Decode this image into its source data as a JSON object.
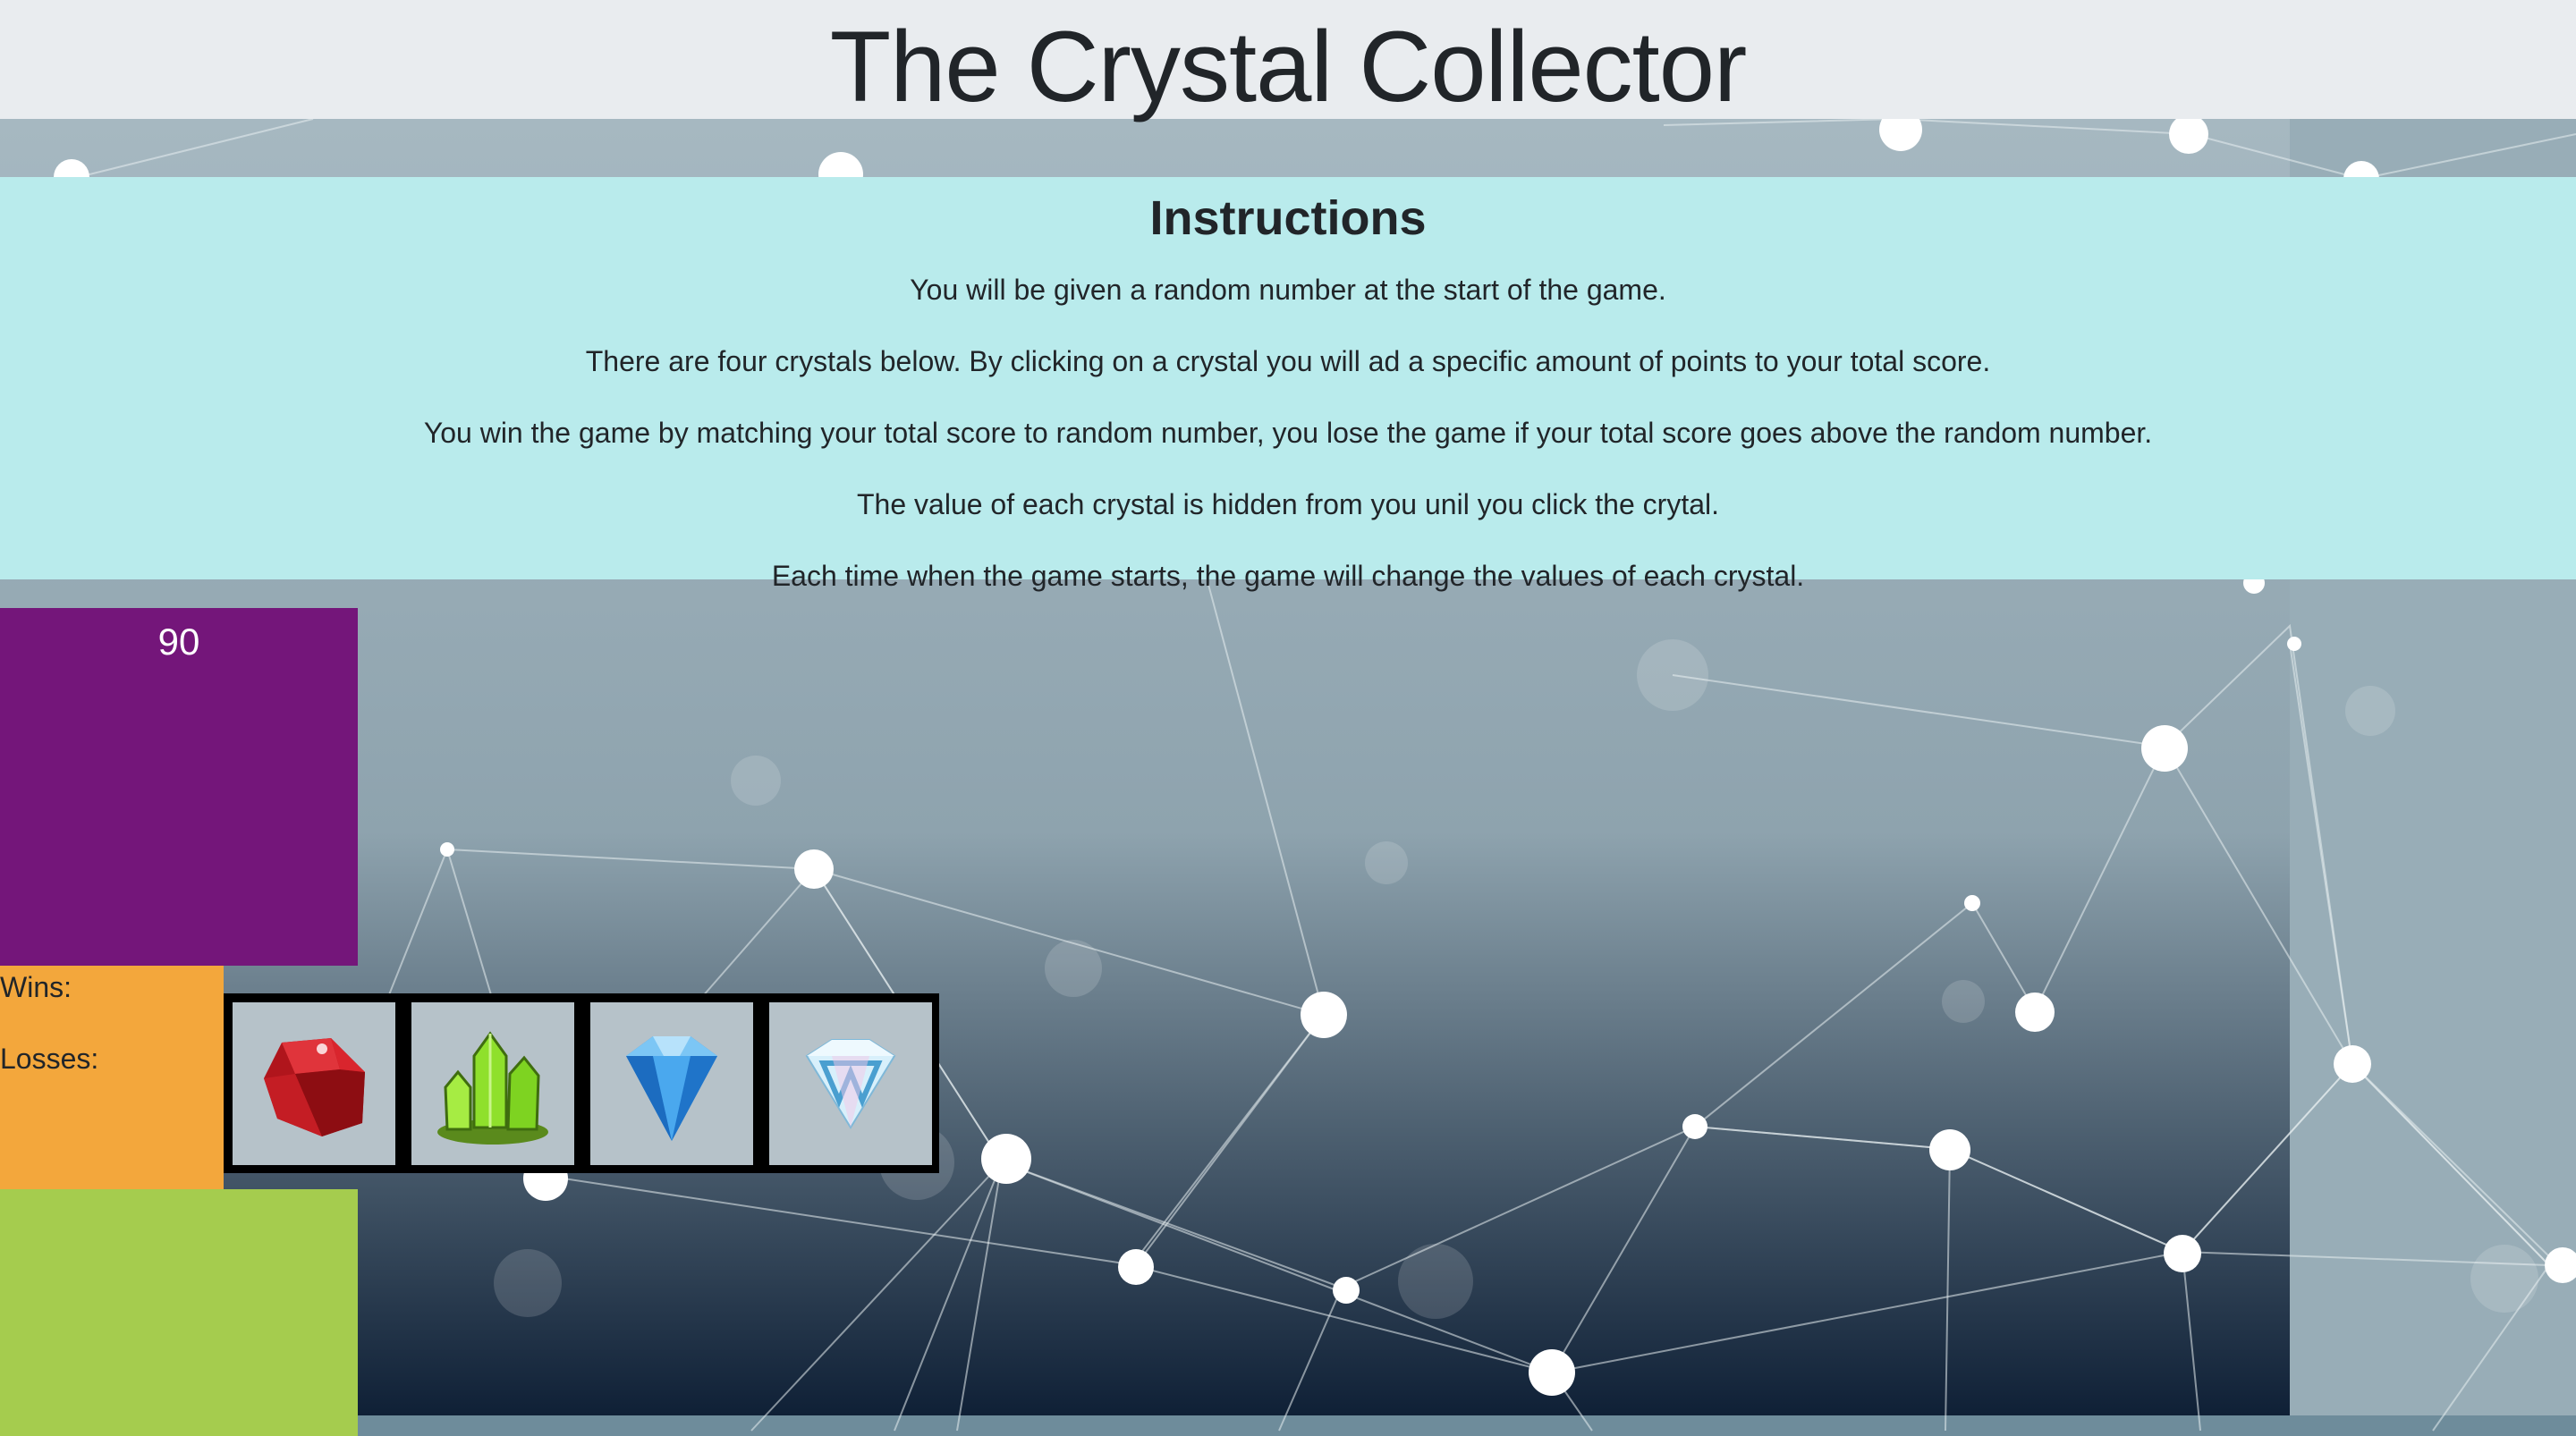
{
  "header": {
    "title": "The Crystal Collector"
  },
  "instructions": {
    "heading": "Instructions",
    "lines": [
      "You will be given a random number at the start of the game.",
      "There are four crystals below. By clicking on a crystal you will ad a specific amount of points to your total score.",
      "You win the game by matching your total score to random number, you lose the game if your total score goes above the random number.",
      "The value of each crystal is hidden from you unil you click the crytal.",
      "Each time when the game starts, the game will change the values of each crystal."
    ]
  },
  "game": {
    "target_number": "90",
    "wins_label": "Wins:",
    "losses_label": "Losses:",
    "crystals": [
      {
        "icon": "red-ruby-icon",
        "color": "#c0151c"
      },
      {
        "icon": "green-crystal-icon",
        "color": "#7ed321"
      },
      {
        "icon": "blue-diamond-icon",
        "color": "#2f8fe0"
      },
      {
        "icon": "white-diamond-icon",
        "color": "#bfe6f7"
      }
    ]
  },
  "colors": {
    "header_bg": "#e9ecef",
    "instructions_bg": "#b9ebec",
    "target_bg": "#74167a",
    "score_bg": "#f3a73c",
    "total_bg": "#a5cc4e"
  }
}
